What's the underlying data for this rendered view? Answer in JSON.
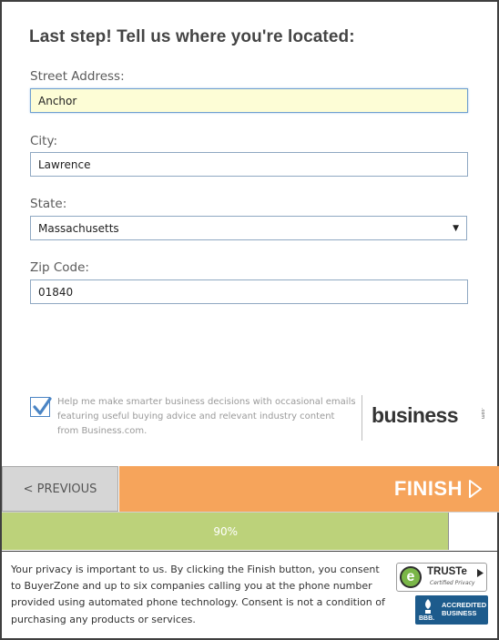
{
  "form": {
    "heading": "Last step! Tell us where you're located:",
    "street": {
      "label": "Street Address:",
      "value": "Anchor"
    },
    "city": {
      "label": "City:",
      "value": "Lawrence"
    },
    "state": {
      "label": "State:",
      "value": "Massachusetts"
    },
    "zip": {
      "label": "Zip Code:",
      "value": "01840"
    }
  },
  "consent": {
    "checked": true,
    "text": "Help me make smarter business decisions with occasional emails featuring useful buying advice and relevant industry content from Business.com.",
    "brand": "business",
    "brand_suffix": ".com"
  },
  "navigation": {
    "previous_label": "< PREVIOUS",
    "finish_label": "FINISH"
  },
  "progress": {
    "percent": 90,
    "label": "90%"
  },
  "footer": {
    "privacy_text": "Your privacy is important to us. By clicking the Finish button, you consent to BuyerZone and up to six companies calling you at the phone number provided using automated phone technology. Consent is not a condition of purchasing any products or services.",
    "truste_name": "TRUSTe",
    "truste_sub": "Certified Privacy",
    "bbb_mark": "BBB.",
    "bbb_text": "ACCREDITED BUSINESS"
  },
  "colors": {
    "finish": "#f6a45b",
    "progress": "#bcd27a",
    "focus_fill": "#fdfdd6",
    "checkbox": "#4a84c4",
    "bbb": "#1d5b8c",
    "truste": "#7ab648"
  },
  "icons": [
    "check-icon",
    "dropdown-arrow-icon",
    "finish-arrow-icon",
    "truste-e-icon",
    "bbb-torch-icon"
  ]
}
